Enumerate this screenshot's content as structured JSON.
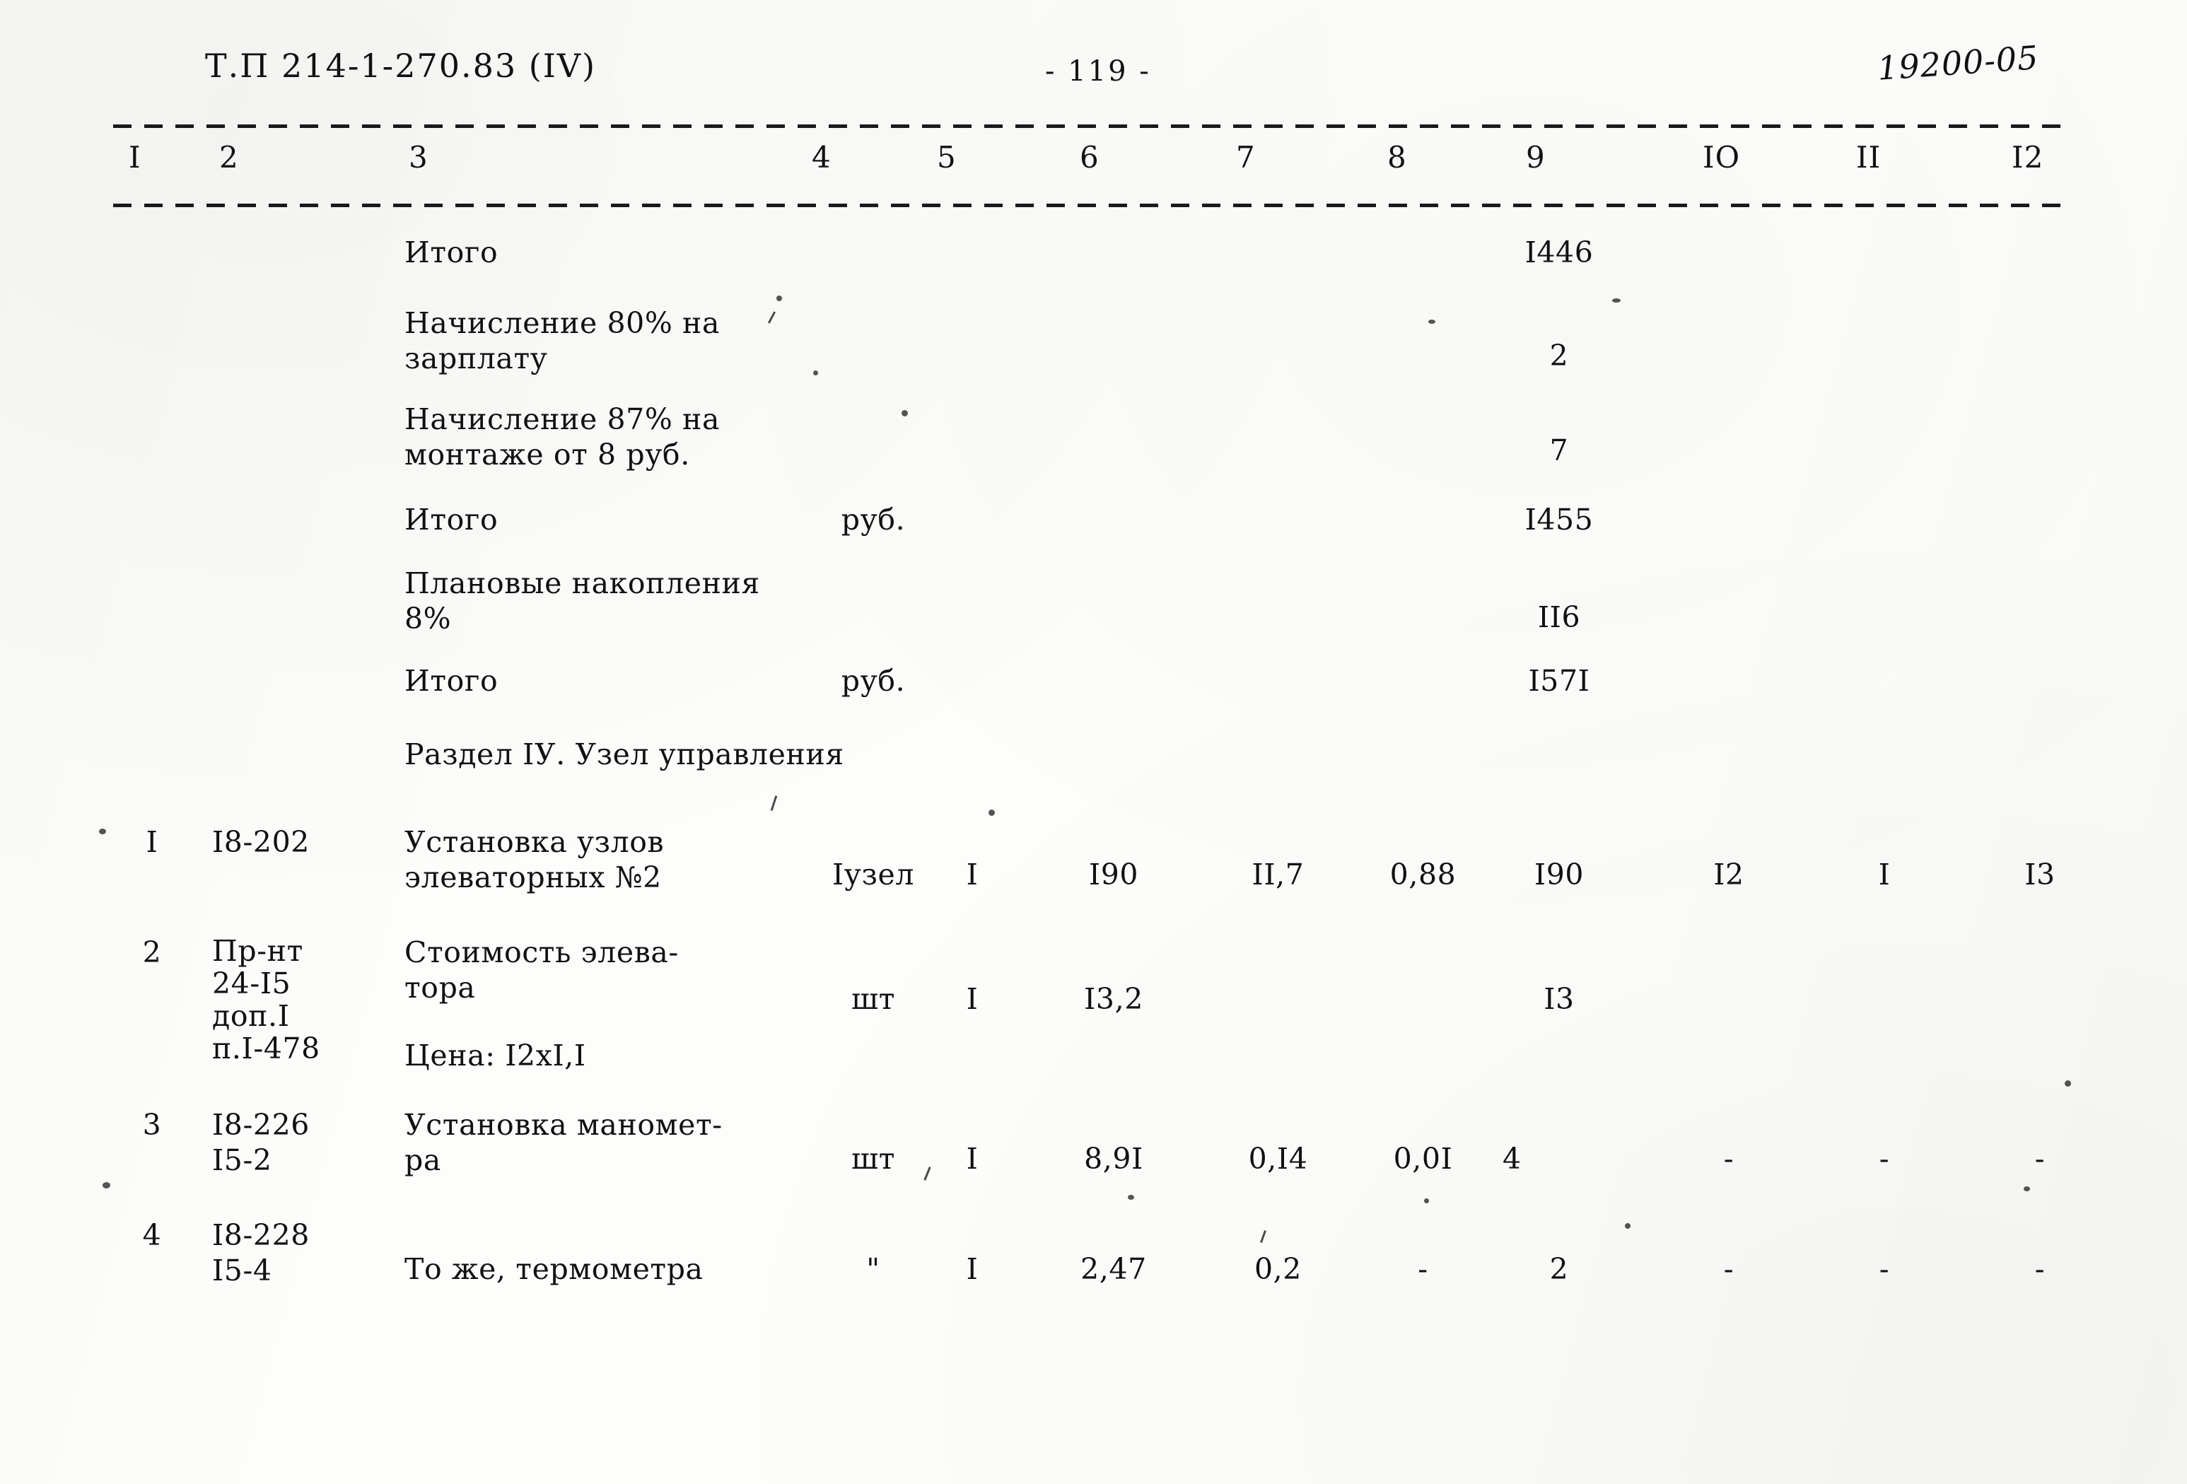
{
  "page": {
    "document_code": "Т.П  214-1-270.83 (IV)",
    "page_number": "- 119 -",
    "archive_stamp": "19200-05"
  },
  "table": {
    "column_numbers": [
      "I",
      "2",
      "3",
      "4",
      "5",
      "6",
      "7",
      "8",
      "9",
      "IO",
      "II",
      "I2"
    ],
    "section_heading": "Раздел IУ. Узел управления",
    "summary_rows": [
      {
        "label": "Итого",
        "unit": "",
        "col6": "",
        "col7": "",
        "col8": "",
        "col9": "I446",
        "col10": "",
        "col11": "",
        "col12": ""
      },
      {
        "label": "Начисление 80% на\nзарплату",
        "unit": "",
        "col6": "",
        "col7": "",
        "col8": "",
        "col9": "2",
        "col10": "",
        "col11": "",
        "col12": ""
      },
      {
        "label": "Начисление 87% на\nмонтаже от 8 руб.",
        "unit": "",
        "col6": "",
        "col7": "",
        "col8": "",
        "col9": "7",
        "col10": "",
        "col11": "",
        "col12": ""
      },
      {
        "label": "Итого",
        "unit": "руб.",
        "col6": "",
        "col7": "",
        "col8": "",
        "col9": "I455",
        "col10": "",
        "col11": "",
        "col12": ""
      },
      {
        "label": "Плановые накопления\n8%",
        "unit": "",
        "col6": "",
        "col7": "",
        "col8": "",
        "col9": "II6",
        "col10": "",
        "col11": "",
        "col12": ""
      },
      {
        "label": "Итого",
        "unit": "руб.",
        "col6": "",
        "col7": "",
        "col8": "",
        "col9": "I57I",
        "col10": "",
        "col11": "",
        "col12": ""
      }
    ],
    "item_rows": [
      {
        "no": "I",
        "code": "I8-202",
        "name": "Установка узлов\nэлеваторных №2",
        "unit": "Iузел",
        "qty": "I",
        "col6": "I90",
        "col7": "II,7",
        "col8": "0,88",
        "col9": "I90",
        "col10": "I2",
        "col11": "I",
        "col12": "I3"
      },
      {
        "no": "2",
        "code": "Пр-нт\n24-I5\nдоп.I\nп.I-478",
        "name": "Стоимость элева-\nтора",
        "name_extra": "Цена: I2xI,I",
        "unit": "шт",
        "qty": "I",
        "col6": "I3,2",
        "col7": "",
        "col8": "",
        "col9": "I3",
        "col10": "",
        "col11": "",
        "col12": ""
      },
      {
        "no": "3",
        "code": "I8-226\nI5-2",
        "name": "Установка маномет-\nра",
        "unit": "шт",
        "qty": "I",
        "col6": "8,9I",
        "col7": "0,I4",
        "col8": "0,0I",
        "col9": "4",
        "col10": "-",
        "col11": "-",
        "col12": "-"
      },
      {
        "no": "4",
        "code": "I8-228\nI5-4",
        "name": "То же, термометра",
        "unit": "\"",
        "qty": "I",
        "col6": "2,47",
        "col7": "0,2",
        "col8": "-",
        "col9": "2",
        "col10": "-",
        "col11": "-",
        "col12": "-"
      }
    ]
  }
}
